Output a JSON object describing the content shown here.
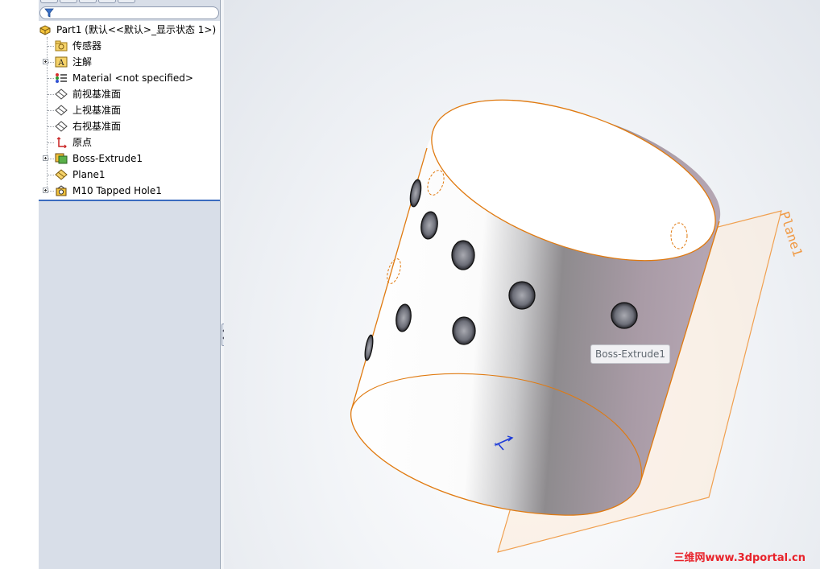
{
  "feature_tree": {
    "root": {
      "label": "Part1  (默认<<默认>_显示状态 1>)"
    },
    "items": [
      {
        "label": "传感器",
        "icon": "sensors-folder-icon",
        "expandable": false
      },
      {
        "label": "注解",
        "icon": "annotations-icon",
        "expandable": true
      },
      {
        "label": "Material <not specified>",
        "icon": "material-icon",
        "expandable": false
      },
      {
        "label": "前视基准面",
        "icon": "plane-icon",
        "expandable": false
      },
      {
        "label": "上视基准面",
        "icon": "plane-icon",
        "expandable": false
      },
      {
        "label": "右视基准面",
        "icon": "plane-icon",
        "expandable": false
      },
      {
        "label": "原点",
        "icon": "origin-icon",
        "expandable": false
      },
      {
        "label": "Boss-Extrude1",
        "icon": "extrude-feature-icon",
        "expandable": true
      },
      {
        "label": "Plane1",
        "icon": "plane-icon",
        "expandable": false
      },
      {
        "label": "M10 Tapped Hole1",
        "icon": "hole-wizard-icon",
        "expandable": true
      }
    ]
  },
  "viewport": {
    "plane_label": "Plane1",
    "tooltip": "Boss-Extrude1",
    "watermark": "三维网www.3dportal.cn",
    "colors": {
      "edge": "#e07a10",
      "plane_fill": "#fdebd8",
      "selection_blue": "#1c3ad8"
    }
  }
}
